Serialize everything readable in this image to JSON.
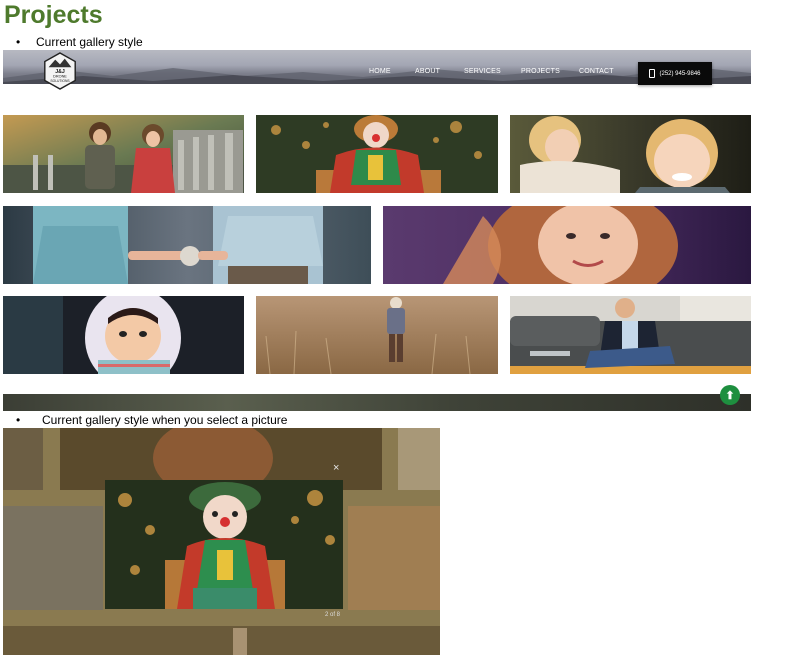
{
  "doc": {
    "title": "Projects",
    "bullet1": "Current gallery style",
    "bullet2": "Current gallery style when you select a picture",
    "bullet_glyph": "•"
  },
  "site": {
    "logo_lines": [
      "J&J",
      "DRONE",
      "SOLUTIONS"
    ],
    "nav": [
      "HOME",
      "ABOUT",
      "SERVICES",
      "PROJECTS",
      "CONTACT"
    ],
    "phone": "(252) 945-9846",
    "phone_icon": "phone-icon",
    "up_icon": "arrow-up-icon",
    "up_glyph": "⬆"
  },
  "gallery": {
    "photos": [
      {
        "name": "photo-kids-by-fence"
      },
      {
        "name": "photo-clown-doll"
      },
      {
        "name": "photo-two-toddlers"
      },
      {
        "name": "photo-holding-hands"
      },
      {
        "name": "photo-smiling-girl"
      },
      {
        "name": "photo-hooded-child"
      },
      {
        "name": "photo-child-in-field"
      },
      {
        "name": "photo-man-with-laptop"
      }
    ]
  },
  "lightbox": {
    "close_glyph": "×",
    "counter": "2 of 8"
  },
  "colors": {
    "title_green": "#4e7a2c",
    "up_button": "#1e8f3f",
    "phone_button": "#0a0a0a"
  }
}
